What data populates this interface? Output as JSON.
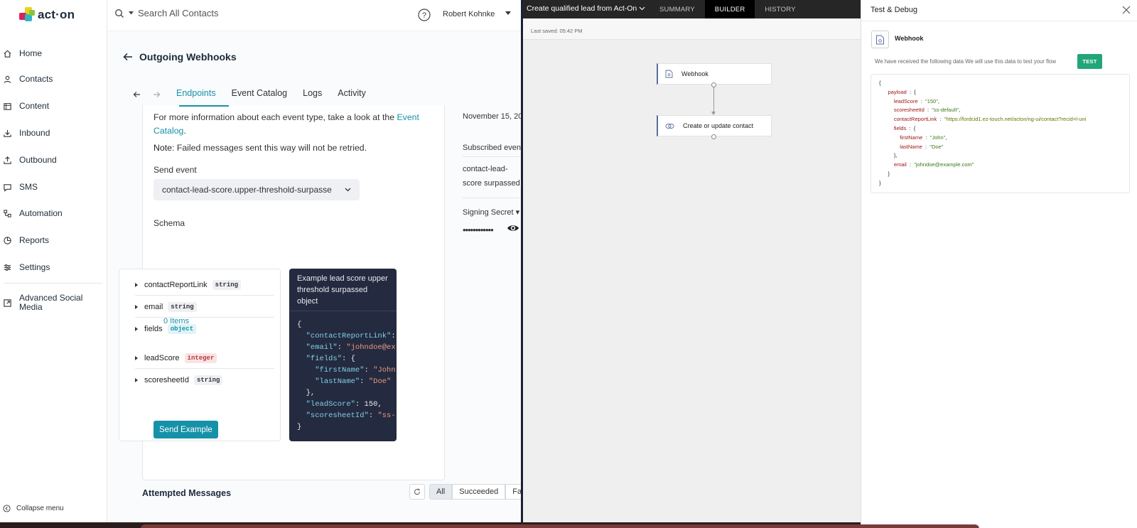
{
  "sidebar": {
    "logo_text": "act·on",
    "items": [
      {
        "label": "Home",
        "icon": "home-icon"
      },
      {
        "label": "Contacts",
        "icon": "contacts-icon"
      },
      {
        "label": "Content",
        "icon": "content-icon"
      },
      {
        "label": "Inbound",
        "icon": "inbound-icon"
      },
      {
        "label": "Outbound",
        "icon": "outbound-icon"
      },
      {
        "label": "SMS",
        "icon": "sms-icon"
      },
      {
        "label": "Automation",
        "icon": "automation-icon"
      },
      {
        "label": "Reports",
        "icon": "reports-icon"
      },
      {
        "label": "Settings",
        "icon": "settings-icon"
      },
      {
        "label": "Advanced Social Media",
        "icon": "social-media-icon"
      }
    ],
    "collapse_label": "Collapse menu"
  },
  "topbar": {
    "search_placeholder": "Search All Contacts",
    "user_name": "Robert Kohnke"
  },
  "page": {
    "title": "Outgoing Webhooks",
    "tabs": [
      {
        "label": "Endpoints",
        "active": true
      },
      {
        "label": "Event Catalog",
        "active": false
      },
      {
        "label": "Logs",
        "active": false
      },
      {
        "label": "Activity",
        "active": false
      }
    ]
  },
  "endpoint": {
    "info_text": "For more information about each event type, take a look at the",
    "info_link": "Event Catalog",
    "info_end": ".",
    "note_bold": "Note:",
    "note_text": " Failed messages sent this way will not be retried.",
    "send_event_label": "Send event",
    "send_event_value": "contact-lead-score.upper-threshold-surpasse",
    "schema_label": "Schema",
    "schema_fields": [
      {
        "name": "contactReportLink",
        "type": "string"
      },
      {
        "name": "email",
        "type": "string"
      },
      {
        "name": "fields",
        "type": "object"
      },
      {
        "name": "leadScore",
        "type": "integer"
      },
      {
        "name": "scoresheetId",
        "type": "string"
      }
    ],
    "zero_items": "0 Items",
    "example_title": "Example lead score upper threshold surpassed object",
    "send_example_label": "Send Example"
  },
  "side_info": {
    "date": "November 15, 20",
    "subscribed_label": "Subscribed event",
    "subscribed_value": "contact-lead-score surpassed",
    "signing_label": "Signing Secret",
    "secret_mask": "••••••••••••"
  },
  "attempted": {
    "label": "Attempted Messages",
    "filters": [
      "All",
      "Succeeded",
      "Fail"
    ]
  },
  "flow": {
    "title": "Create qualified lead from Act-On",
    "tabs": [
      {
        "label": "SUMMARY",
        "active": false
      },
      {
        "label": "BUILDER",
        "active": true
      },
      {
        "label": "HISTORY",
        "active": false
      }
    ],
    "last_saved": "Last saved: 05:42 PM",
    "nodes": [
      {
        "label": "Webhook",
        "icon": "webhook-icon"
      },
      {
        "label": "Create or update contact",
        "icon": "link-icon"
      }
    ]
  },
  "debug": {
    "title": "Test & Debug",
    "webhook_label": "Webhook",
    "received_text": "We have received the following data We will use this data to test your flow",
    "test_label": "TEST"
  },
  "colors": {
    "accent": "#1592a8",
    "test_green": "#21a67a",
    "dark_bar": "#262626",
    "code_bg": "#242a3f"
  }
}
